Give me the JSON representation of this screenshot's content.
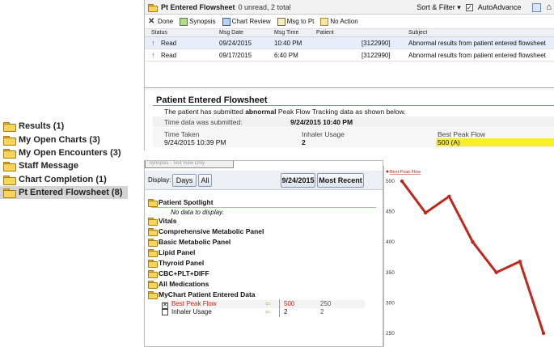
{
  "folders": [
    {
      "label": "Results (1)",
      "selected": false
    },
    {
      "label": "My Open Charts (3)",
      "selected": false
    },
    {
      "label": "My Open Encounters (3)",
      "selected": false
    },
    {
      "label": "Staff Message",
      "selected": false
    },
    {
      "label": "Chart Completion (1)",
      "selected": false
    },
    {
      "label": "Pt Entered Flowsheet (8)",
      "selected": true
    }
  ],
  "inbox": {
    "title": "Pt Entered Flowsheet",
    "count": "0 unread, 2 total",
    "sort_filter": "Sort & Filter",
    "auto_advance": "AutoAdvance",
    "auto_advance_checked": true,
    "toolbar": {
      "done": "Done",
      "synopsis": "Synopsis",
      "chart_review": "Chart Review",
      "msg_to_pt": "Msg to Pt",
      "no_action": "No Action"
    },
    "columns": [
      "Status",
      "Msg Date",
      "Msg Time",
      "Patient",
      "Subject"
    ],
    "rows": [
      {
        "status": "Read",
        "date": "09/24/2015",
        "time": "10:40 PM",
        "patient": "[3122990]",
        "subject": "Abnormal results from patient entered flowsheet"
      },
      {
        "status": "Read",
        "date": "09/17/2015",
        "time": "6:40 PM",
        "patient": "[3122990]",
        "subject": "Abnormal results from patient entered flowsheet"
      }
    ]
  },
  "detail": {
    "title": "Patient Entered Flowsheet",
    "submitted_pre": "The patient has submitted",
    "submitted_bold": "abnormal",
    "submitted_post": "Peak Flow Tracking data as shown below.",
    "time_label": "Time data was submitted:",
    "time_value": "9/24/2015 10:40 PM",
    "headers": [
      "Time Taken",
      "Inhaler Usage",
      "Best Peak Flow"
    ],
    "values": [
      "9/24/2015 10:39 PM",
      "2",
      "500 (A)"
    ]
  },
  "flowsheet": {
    "cut_tab": "Synopsis - Test View Only",
    "display_label": "Display:",
    "days_btn": "Days",
    "all_btn": "All",
    "date_btn": "9/24/2015",
    "recent_btn": "Most Recent",
    "spotlight": "Patient Spotlight",
    "no_data": "No data to display.",
    "sections": [
      "Vitals",
      "Comprehensive Metabolic Panel",
      "Basic Metabolic Panel",
      "Lipid Panel",
      "Thyroid Panel",
      "CBC+PLT+DIFF",
      "All Medications",
      "MyChart Patient Entered Data"
    ],
    "rows": [
      {
        "name": "Best Peak Flow",
        "v1": "500",
        "v2": "250",
        "checked": true
      },
      {
        "name": "Inhaler Usage",
        "v1": "2",
        "v2": "2",
        "checked": false
      }
    ]
  },
  "chart_data": {
    "type": "line",
    "series": [
      {
        "name": "Best Peak Flow",
        "values": [
          500,
          448,
          475,
          400,
          350,
          368,
          250
        ]
      }
    ],
    "yticks": [
      500,
      450,
      400,
      350,
      300,
      250
    ],
    "ylim": [
      250,
      500
    ],
    "color": "#c0281e"
  }
}
